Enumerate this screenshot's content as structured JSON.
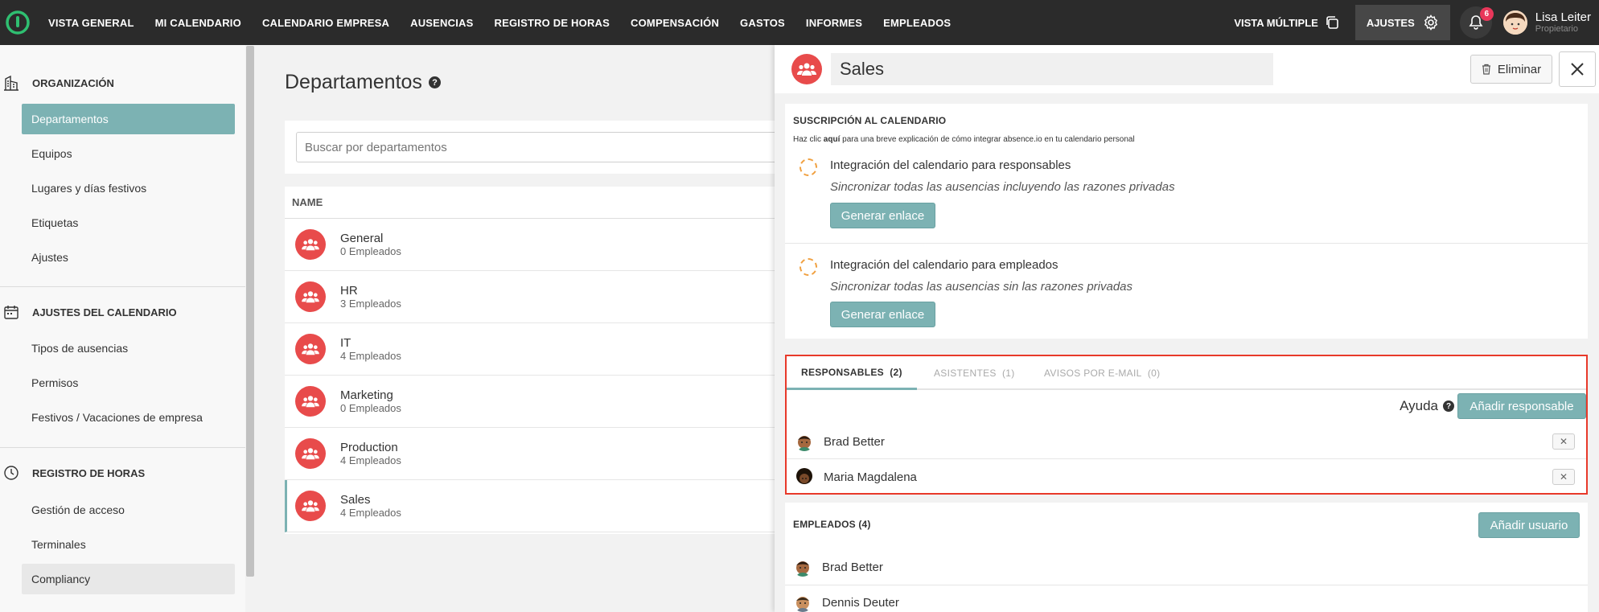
{
  "topnav": {
    "items": [
      "VISTA GENERAL",
      "MI CALENDARIO",
      "CALENDARIO EMPRESA",
      "AUSENCIAS",
      "REGISTRO DE HORAS",
      "COMPENSACIÓN",
      "GASTOS",
      "INFORMES",
      "EMPLEADOS"
    ],
    "vista_multiple": "VISTA MÚLTIPLE",
    "ajustes": "AJUSTES",
    "notifications_count": "6",
    "user_name": "Lisa Leiter",
    "user_role": "Propietario"
  },
  "sidebar": {
    "organizacion": {
      "title": "ORGANIZACIÓN",
      "items": [
        "Departamentos",
        "Equipos",
        "Lugares y días festivos",
        "Etiquetas",
        "Ajustes"
      ]
    },
    "calendario": {
      "title": "AJUSTES DEL CALENDARIO",
      "items": [
        "Tipos de ausencias",
        "Permisos",
        "Festivos / Vacaciones de empresa"
      ]
    },
    "registro": {
      "title": "REGISTRO DE HORAS",
      "items": [
        "Gestión de acceso",
        "Terminales",
        "Compliancy"
      ]
    }
  },
  "main": {
    "title": "Departamentos",
    "search_placeholder": "Buscar por departamentos",
    "column_header": "NAME",
    "departments": [
      {
        "name": "General",
        "count": "0 Empleados"
      },
      {
        "name": "HR",
        "count": "3 Empleados"
      },
      {
        "name": "IT",
        "count": "4 Empleados"
      },
      {
        "name": "Marketing",
        "count": "0 Empleados"
      },
      {
        "name": "Production",
        "count": "4 Empleados"
      },
      {
        "name": "Sales",
        "count": "4 Empleados"
      }
    ]
  },
  "panel": {
    "name": "Sales",
    "delete_label": "Eliminar",
    "subscription": {
      "title": "SUSCRIPCIÓN AL CALENDARIO",
      "help_prefix": "Haz clic ",
      "help_link": "aquí",
      "help_suffix": " para una breve explicación de cómo integrar absence.io en tu calendario personal",
      "integrations": [
        {
          "title": "Integración del calendario para responsables",
          "desc": "Sincronizar todas las ausencias incluyendo las razones privadas",
          "button": "Generar enlace"
        },
        {
          "title": "Integración del calendario para empleados",
          "desc": "Sincronizar todas las ausencias sin las razones privadas",
          "button": "Generar enlace"
        }
      ]
    },
    "tabs": [
      {
        "label": "RESPONSABLES",
        "count": "(2)"
      },
      {
        "label": "ASISTENTES",
        "count": "(1)"
      },
      {
        "label": "AVISOS POR E-MAIL",
        "count": "(0)"
      }
    ],
    "help_label": "Ayuda",
    "add_responsable": "Añadir responsable",
    "responsables": [
      "Brad Better",
      "Maria Magdalena"
    ],
    "employees_title": "EMPLEADOS (4)",
    "add_user": "Añadir usuario",
    "employees": [
      "Brad Better",
      "Dennis Deuter"
    ]
  },
  "colors": {
    "accent": "#7cb2b3",
    "topbar": "#2b2b2b",
    "dept_icon": "#e84b4b",
    "highlight_border": "#e8392a",
    "badge": "#e8375a"
  }
}
